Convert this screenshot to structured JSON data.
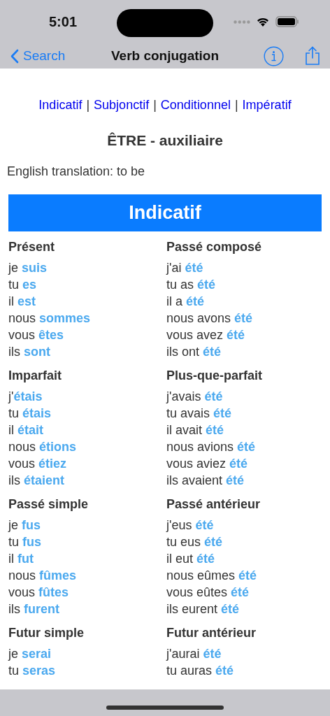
{
  "status_bar": {
    "time": "5:01"
  },
  "nav_bar": {
    "back_label": "Search",
    "title": "Verb conjugation"
  },
  "mood_links": [
    {
      "kind": "link",
      "label": "Indicatif"
    },
    {
      "kind": "separator",
      "label": "|"
    },
    {
      "kind": "link",
      "label": "Subjonctif"
    },
    {
      "kind": "separator",
      "label": "|"
    },
    {
      "kind": "link",
      "label": "Conditionnel"
    },
    {
      "kind": "separator",
      "label": "|"
    },
    {
      "kind": "link",
      "label": "Impératif"
    }
  ],
  "verb_title": "ÊTRE - auxiliaire",
  "translation": "English translation: to be",
  "section_header": "Indicatif",
  "tenses": [
    {
      "name": "Présent",
      "lines": [
        "je **suis**",
        "tu **es**",
        "il **est**",
        "nous **sommes**",
        "vous **êtes**",
        "ils **sont**"
      ]
    },
    {
      "name": "Passé composé",
      "lines": [
        "j'ai **été**",
        "tu as **été**",
        "il a **été**",
        "nous avons **été**",
        "vous avez **été**",
        "ils ont **été**"
      ]
    },
    {
      "name": "Imparfait",
      "lines": [
        "j'**étais**",
        "tu **étais**",
        "il **était**",
        "nous **étions**",
        "vous **étiez**",
        "ils **étaient**"
      ]
    },
    {
      "name": "Plus-que-parfait",
      "lines": [
        "j'avais **été**",
        "tu avais **été**",
        "il avait **été**",
        "nous avions **été**",
        "vous aviez **été**",
        "ils avaient **été**"
      ]
    },
    {
      "name": "Passé simple",
      "lines": [
        "je **fus**",
        "tu **fus**",
        "il **fut**",
        "nous **fûmes**",
        "vous **fûtes**",
        "ils **furent**"
      ]
    },
    {
      "name": "Passé antérieur",
      "lines": [
        "j'eus **été**",
        "tu eus **été**",
        "il eut **été**",
        "nous eûmes **été**",
        "vous eûtes **été**",
        "ils eurent **été**"
      ]
    },
    {
      "name": "Futur simple",
      "lines": [
        "je **serai**",
        "tu **seras**"
      ]
    },
    {
      "name": "Futur antérieur",
      "lines": [
        "j'aurai **été**",
        "tu auras **été**"
      ]
    }
  ]
}
